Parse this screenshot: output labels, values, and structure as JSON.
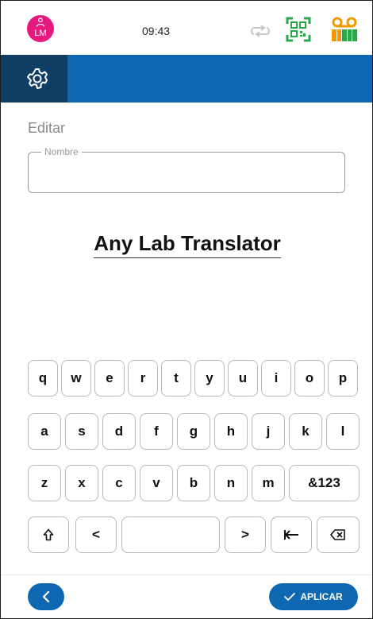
{
  "status": {
    "avatar_initials": "LM",
    "time": "09:43",
    "icons": [
      "person-icon",
      "sync-icon",
      "qr-code-icon",
      "voicemail-icon"
    ]
  },
  "header": {
    "icon": "gear-icon"
  },
  "page": {
    "title": "Editar"
  },
  "form": {
    "name_label": "Nombre",
    "name_value": "",
    "display_text": "Any Lab Translator"
  },
  "keyboard": {
    "row1": [
      "q",
      "w",
      "e",
      "r",
      "t",
      "y",
      "u",
      "i",
      "o",
      "p"
    ],
    "row2": [
      "a",
      "s",
      "d",
      "f",
      "g",
      "h",
      "j",
      "k",
      "l"
    ],
    "row3": [
      "z",
      "x",
      "c",
      "v",
      "b",
      "n",
      "m",
      "&123"
    ],
    "row4_left": "<",
    "row4_right": ">",
    "row4_icons": [
      "shift-icon",
      "space-key",
      "tab-icon",
      "backspace-icon"
    ]
  },
  "footer": {
    "apply_label": "APLICAR",
    "icons": [
      "chevron-left-icon",
      "check-icon"
    ]
  },
  "colors": {
    "primary": "#0f67b1",
    "header_dark": "#103d63",
    "avatar": "#e6197f",
    "qr": "#2aa84a",
    "voicemail": "#f29900"
  }
}
